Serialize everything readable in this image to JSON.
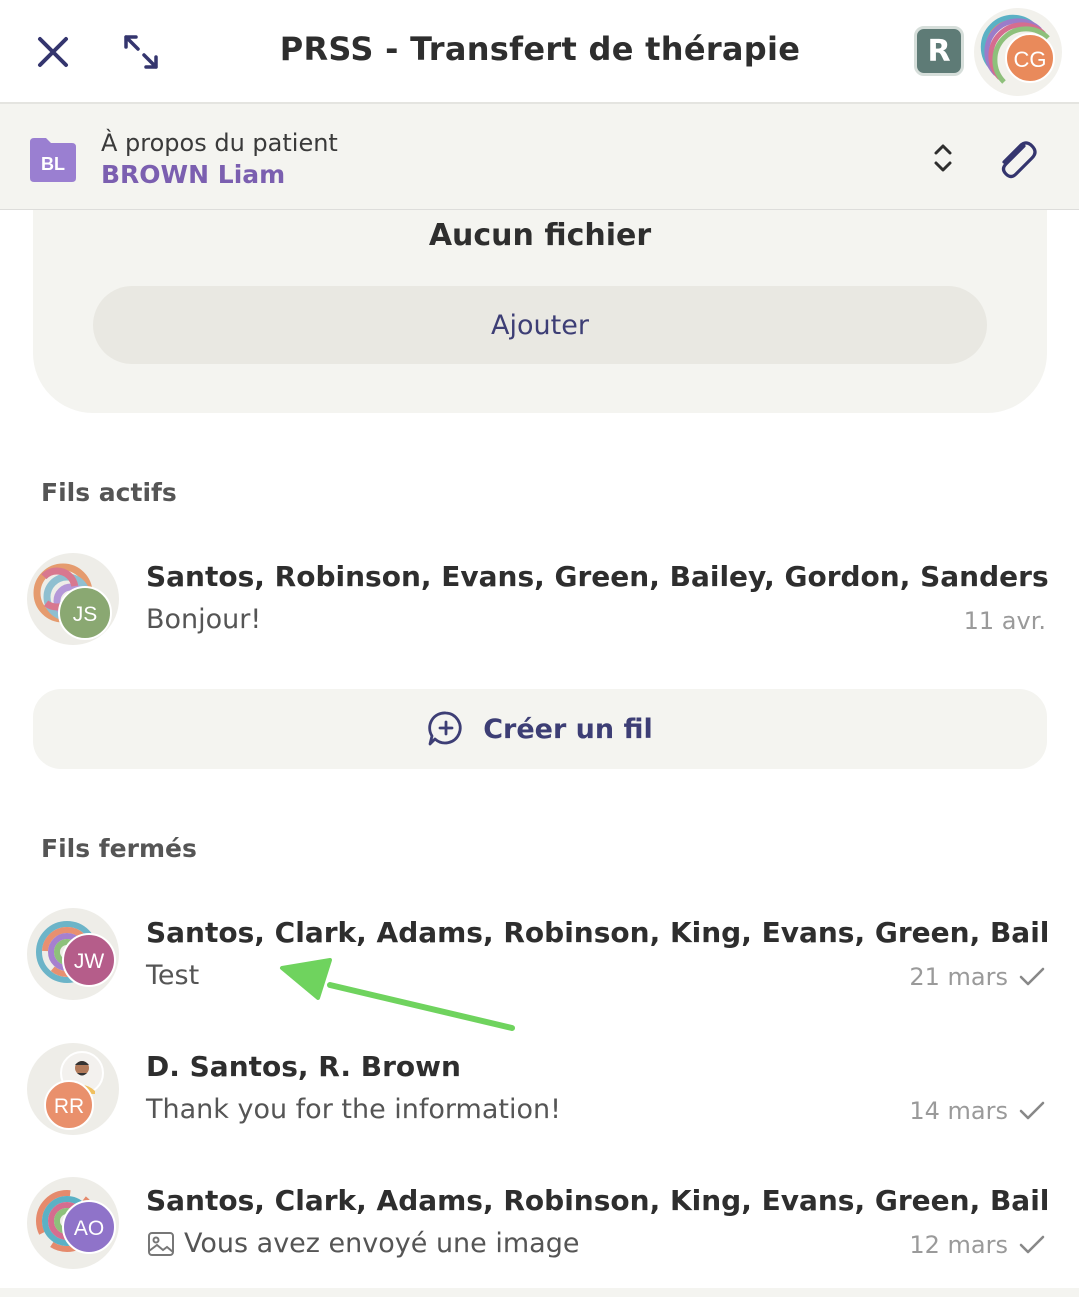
{
  "header": {
    "title": "PRSS - Transfert de thérapie",
    "badge_letter": "R",
    "user_initials": "CG"
  },
  "patient": {
    "label": "À propos du patient",
    "name": "BROWN Liam",
    "initials": "BL"
  },
  "files": {
    "empty_text": "Aucun fichier",
    "add_label": "Ajouter"
  },
  "active": {
    "title": "Fils actifs",
    "threads": [
      {
        "initials": "JS",
        "names": "Santos, Robinson, Evans, Green, Bailey, Gordon, Sanders, Brown, Lee",
        "message": "Bonjour!",
        "date": "11 avr."
      }
    ],
    "create_label": "Créer un fil"
  },
  "closed": {
    "title": "Fils fermés",
    "threads": [
      {
        "initials": "JW",
        "names": "Santos, Clark, Adams, Robinson, King, Evans, Green, Bailey, Sanders",
        "message": "Test",
        "date": "21 mars"
      },
      {
        "initials": "RR",
        "names": "D. Santos, R. Brown",
        "message": "Thank you for the information!",
        "date": "14 mars"
      },
      {
        "initials": "AO",
        "names": "Santos, Clark, Adams, Robinson, King, Evans, Green, Bailey, Olson",
        "message": "Vous avez envoyé une image",
        "date": "12 mars"
      }
    ]
  },
  "colors": {
    "accent_purple": "#7b5fb0",
    "navy": "#3d3e75",
    "arrow_green": "#6fd35e",
    "bg_light": "#f4f4f0"
  }
}
